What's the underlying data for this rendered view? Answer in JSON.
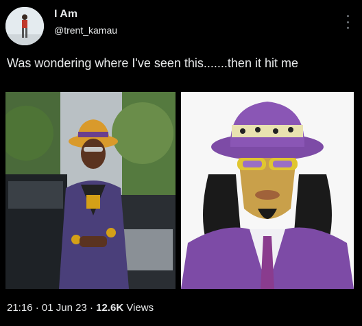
{
  "author": {
    "name": "I Am",
    "handle": "@trent_kamau",
    "avatar_icon": "profile-photo"
  },
  "tweet": {
    "text": "Was wondering where I've seen this.......then it hit me"
  },
  "media": [
    {
      "label": "photo",
      "icon": "man-in-purple-hat-photo"
    },
    {
      "label": "cartoon",
      "icon": "cartoon-character-purple-hat"
    }
  ],
  "meta": {
    "time": "21:16",
    "sep1": " · ",
    "date": "01 Jun 23",
    "sep2": " · ",
    "views_count": "12.6K",
    "views_label": " Views"
  },
  "colors": {
    "background": "#000000",
    "text": "#e7e9ea",
    "purple": "#7b4fa3",
    "gold": "#d4a017"
  }
}
